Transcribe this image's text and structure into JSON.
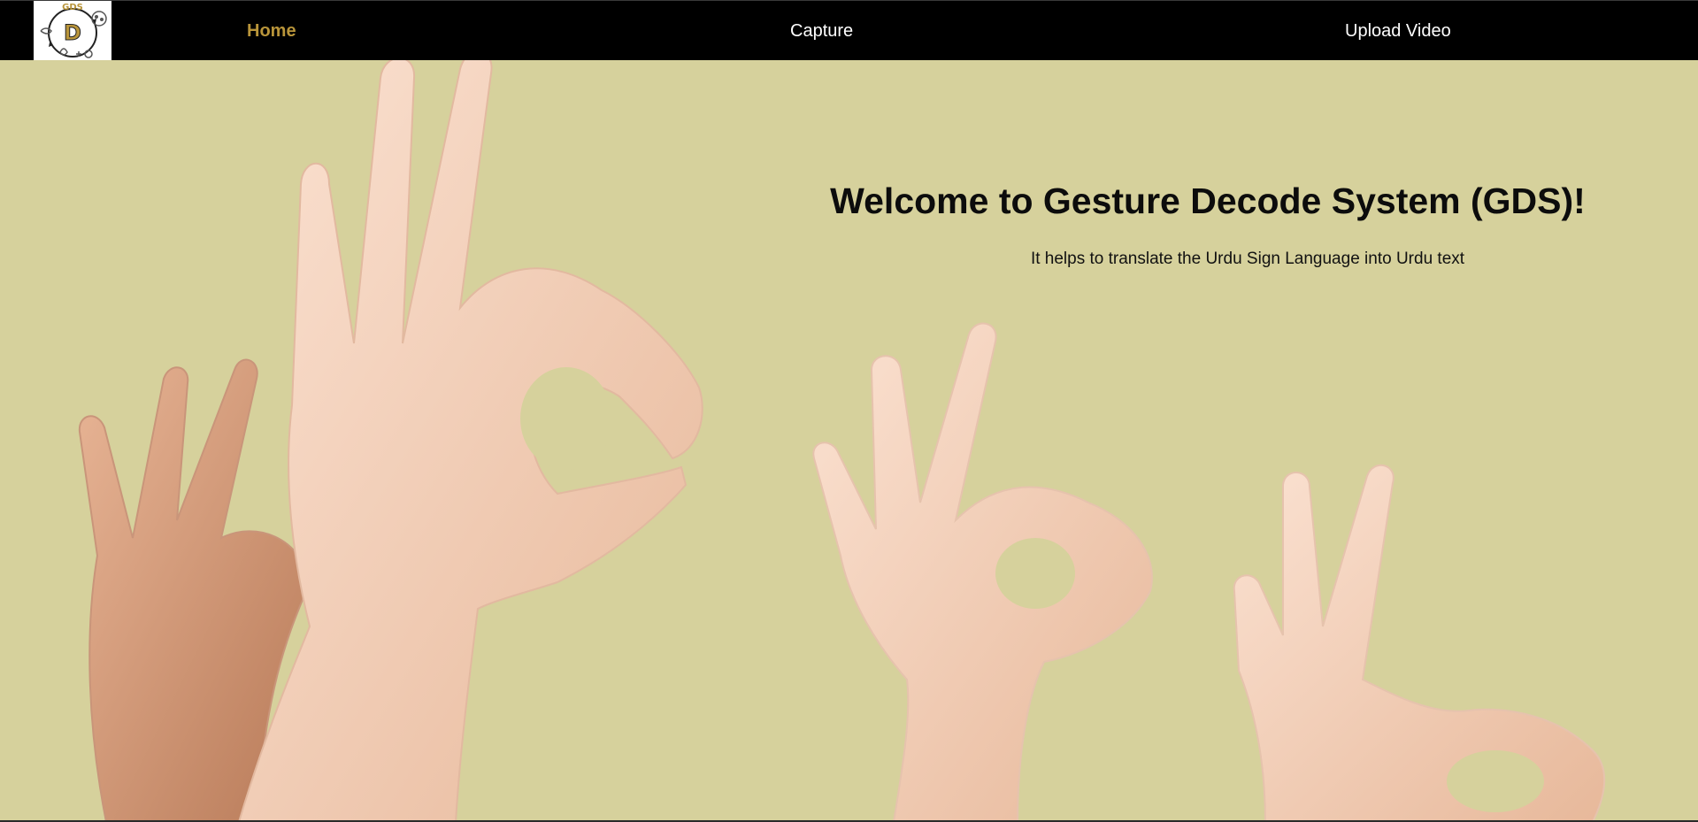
{
  "nav": {
    "logo_text": "GDS",
    "logo_letter": "D",
    "items": [
      {
        "label": "Home",
        "active": true
      },
      {
        "label": "Capture",
        "active": false
      },
      {
        "label": "Upload Video",
        "active": false
      }
    ]
  },
  "hero": {
    "title": "Welcome to Gesture Decode System (GDS)!",
    "subtitle": "It helps to translate the Urdu Sign Language into Urdu text",
    "image": "ok-hand-gestures"
  },
  "colors": {
    "navbar_bg": "#000000",
    "nav_active": "#b9953a",
    "nav_text": "#ffffff",
    "hero_bg": "#d6d19c",
    "skin": "#f2cdb4"
  }
}
